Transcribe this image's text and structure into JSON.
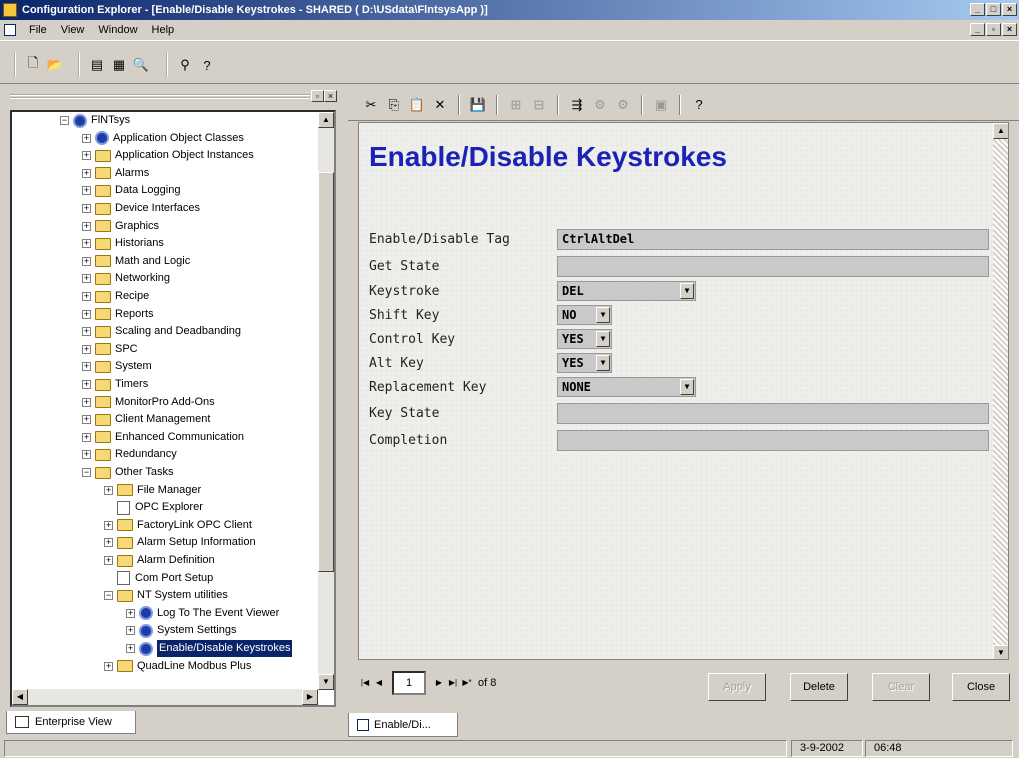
{
  "window": {
    "title": "Configuration Explorer - [Enable/Disable Keystrokes - SHARED  ( D:\\USdata\\FlntsysApp )]",
    "buttons": [
      "_",
      "□",
      "×"
    ]
  },
  "menubar": {
    "items": [
      "File",
      "View",
      "Window",
      "Help"
    ],
    "mdi_buttons": [
      "_",
      "▫",
      "×"
    ]
  },
  "toolbar1": {
    "icons": [
      "new-icon",
      "open-icon",
      "tree-view-icon",
      "grid-icon",
      "find-icon",
      "binoculars-icon",
      "help-icon"
    ]
  },
  "tree": {
    "items": [
      {
        "label": "FlNTsys",
        "level": 0,
        "icon": "server-icon",
        "expander": "−"
      },
      {
        "label": "Application Object Classes",
        "level": 1,
        "icon": "classes-icon",
        "expander": "+"
      },
      {
        "label": "Application Object Instances",
        "level": 1,
        "icon": "folder-icon",
        "expander": "+"
      },
      {
        "label": "Alarms",
        "level": 1,
        "icon": "folder-icon",
        "expander": "+"
      },
      {
        "label": "Data Logging",
        "level": 1,
        "icon": "folder-icon",
        "expander": "+"
      },
      {
        "label": "Device Interfaces",
        "level": 1,
        "icon": "folder-icon",
        "expander": "+"
      },
      {
        "label": "Graphics",
        "level": 1,
        "icon": "folder-icon",
        "expander": "+"
      },
      {
        "label": "Historians",
        "level": 1,
        "icon": "folder-icon",
        "expander": "+"
      },
      {
        "label": "Math and Logic",
        "level": 1,
        "icon": "folder-icon",
        "expander": "+"
      },
      {
        "label": "Networking",
        "level": 1,
        "icon": "folder-icon",
        "expander": "+"
      },
      {
        "label": "Recipe",
        "level": 1,
        "icon": "folder-icon",
        "expander": "+"
      },
      {
        "label": "Reports",
        "level": 1,
        "icon": "folder-icon",
        "expander": "+"
      },
      {
        "label": "Scaling and Deadbanding",
        "level": 1,
        "icon": "folder-icon",
        "expander": "+"
      },
      {
        "label": "SPC",
        "level": 1,
        "icon": "folder-icon",
        "expander": "+"
      },
      {
        "label": "System",
        "level": 1,
        "icon": "folder-icon",
        "expander": "+"
      },
      {
        "label": "Timers",
        "level": 1,
        "icon": "folder-icon",
        "expander": "+"
      },
      {
        "label": "MonitorPro Add-Ons",
        "level": 1,
        "icon": "folder-icon",
        "expander": "+"
      },
      {
        "label": "Client Management",
        "level": 1,
        "icon": "folder-icon",
        "expander": "+"
      },
      {
        "label": "Enhanced Communication",
        "level": 1,
        "icon": "folder-icon",
        "expander": "+"
      },
      {
        "label": "Redundancy",
        "level": 1,
        "icon": "folder-icon",
        "expander": "+"
      },
      {
        "label": "Other Tasks",
        "level": 1,
        "icon": "folder-open-icon",
        "expander": "−"
      },
      {
        "label": "File Manager",
        "level": 2,
        "icon": "folder-icon",
        "expander": "+"
      },
      {
        "label": "OPC Explorer",
        "level": 2,
        "icon": "doc-icon",
        "expander": ""
      },
      {
        "label": "FactoryLink OPC Client",
        "level": 2,
        "icon": "folder-icon",
        "expander": "+"
      },
      {
        "label": "Alarm Setup Information",
        "level": 2,
        "icon": "folder-icon",
        "expander": "+"
      },
      {
        "label": "Alarm Definition",
        "level": 2,
        "icon": "folder-icon",
        "expander": "+"
      },
      {
        "label": "Com Port Setup",
        "level": 2,
        "icon": "comport-icon",
        "expander": ""
      },
      {
        "label": "NT System utilities",
        "level": 2,
        "icon": "folder-open-icon",
        "expander": "−"
      },
      {
        "label": "Log To The Event Viewer",
        "level": 3,
        "icon": "gear-icon",
        "expander": "+"
      },
      {
        "label": "System Settings",
        "level": 3,
        "icon": "gear-icon",
        "expander": "+"
      },
      {
        "label": "Enable/Disable Keystrokes",
        "level": 3,
        "icon": "gear-icon",
        "expander": "+",
        "selected": true
      },
      {
        "label": "QuadLine Modbus Plus",
        "level": 2,
        "icon": "folder-icon",
        "expander": "+"
      }
    ]
  },
  "left_tab": {
    "label": "Enterprise View"
  },
  "form": {
    "title": "Enable/Disable Keystrokes",
    "fields": [
      {
        "label": "Enable/Disable Tag",
        "value": "CtrlAltDel",
        "kind": "text"
      },
      {
        "label": "Get State",
        "value": "",
        "kind": "text"
      },
      {
        "label": "Keystroke",
        "value": "DEL",
        "kind": "select"
      },
      {
        "label": "Shift Key",
        "value": "NO",
        "kind": "select"
      },
      {
        "label": "Control Key",
        "value": "YES",
        "kind": "select"
      },
      {
        "label": "Alt Key",
        "value": "YES",
        "kind": "select"
      },
      {
        "label": "Replacement Key",
        "value": "NONE",
        "kind": "select"
      },
      {
        "label": "Key State",
        "value": "",
        "kind": "text"
      },
      {
        "label": "Completion",
        "value": "",
        "kind": "text"
      }
    ]
  },
  "navigation": {
    "record": "1",
    "of_label": "of 8",
    "buttons": {
      "apply": "Apply",
      "delete": "Delete",
      "clear": "Clear",
      "close": "Close"
    }
  },
  "mdi_tab": {
    "label": "Enable/Di..."
  },
  "statusbar": {
    "date": "3-9-2002",
    "time": "06:48"
  }
}
